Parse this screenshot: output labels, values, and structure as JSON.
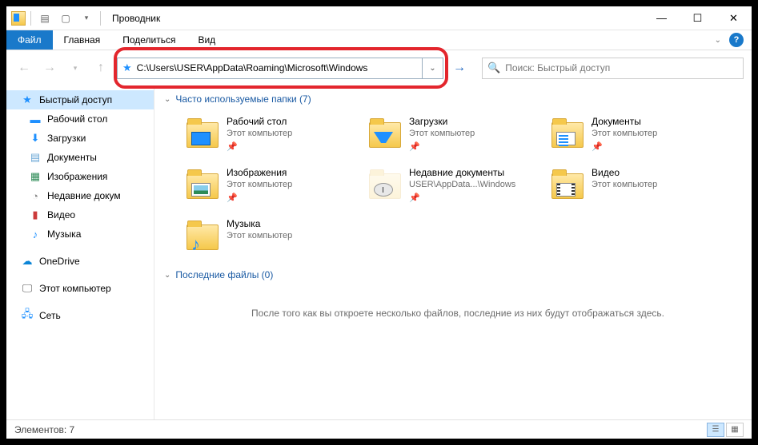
{
  "title": "Проводник",
  "tabs": {
    "file": "Файл",
    "home": "Главная",
    "share": "Поделиться",
    "view": "Вид"
  },
  "address": "C:\\Users\\USER\\AppData\\Roaming\\Microsoft\\Windows",
  "search_placeholder": "Поиск: Быстрый доступ",
  "sidebar": {
    "quick": "Быстрый доступ",
    "items": [
      "Рабочий стол",
      "Загрузки",
      "Документы",
      "Изображения",
      "Недавние докум",
      "Видео",
      "Музыка"
    ],
    "onedrive": "OneDrive",
    "thispc": "Этот компьютер",
    "network": "Сеть"
  },
  "section1": "Часто используемые папки (7)",
  "section2": "Последние файлы (0)",
  "tiles": [
    {
      "name": "Рабочий стол",
      "sub": "Этот компьютер",
      "ov": "ov-desktop",
      "pin": true
    },
    {
      "name": "Загрузки",
      "sub": "Этот компьютер",
      "ov": "ov-down",
      "pin": true
    },
    {
      "name": "Документы",
      "sub": "Этот компьютер",
      "ov": "ov-doc",
      "pin": true
    },
    {
      "name": "Изображения",
      "sub": "Этот компьютер",
      "ov": "ov-img",
      "pin": true
    },
    {
      "name": "Недавние документы",
      "sub": "USER\\AppData...\\Windows",
      "ov": "ov-recent",
      "pin": true
    },
    {
      "name": "Видео",
      "sub": "Этот компьютер",
      "ov": "ov-video",
      "pin": false
    },
    {
      "name": "Музыка",
      "sub": "Этот компьютер",
      "ov": "ov-music",
      "pin": false
    }
  ],
  "empty": "После того как вы откроете несколько файлов, последние из них будут отображаться здесь.",
  "status": "Элементов: 7"
}
